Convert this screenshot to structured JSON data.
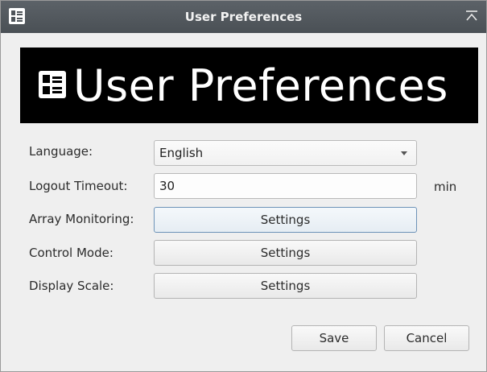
{
  "window": {
    "title": "User Preferences",
    "icon": "preferences-list-icon",
    "collapse_icon": "collapse-up-icon"
  },
  "banner": {
    "text": "User Preferences",
    "icon": "preferences-list-icon"
  },
  "form": {
    "language": {
      "label": "Language:",
      "value": "English"
    },
    "logout_timeout": {
      "label": "Logout Timeout:",
      "value": "30",
      "unit": "min"
    },
    "array_monitoring": {
      "label": "Array Monitoring:",
      "button": "Settings"
    },
    "control_mode": {
      "label": "Control Mode:",
      "button": "Settings"
    },
    "display_scale": {
      "label": "Display Scale:",
      "button": "Settings"
    }
  },
  "actions": {
    "save_label": "Save",
    "cancel_label": "Cancel"
  },
  "colors": {
    "titlebar": "#4f555a",
    "banner_bg": "#000000",
    "window_bg": "#efefef",
    "focus_border": "#6d93b8"
  }
}
